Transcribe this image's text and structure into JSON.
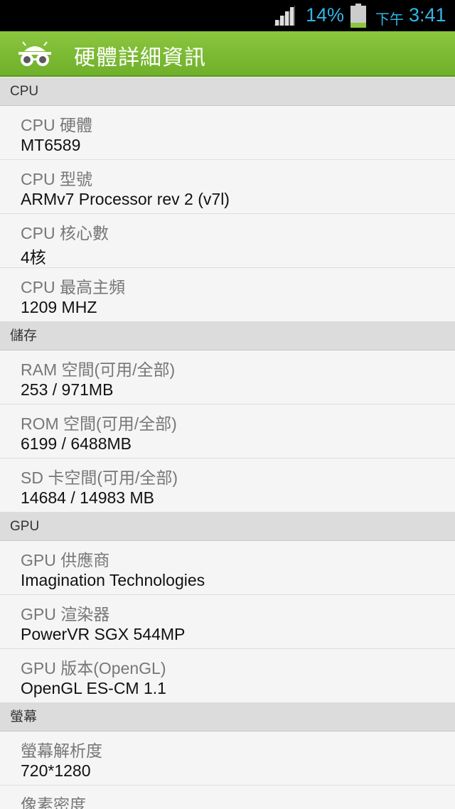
{
  "status_bar": {
    "battery_percent": "14%",
    "time_prefix": "下午",
    "time": "3:41",
    "accent_color": "#33b5e5"
  },
  "action_bar": {
    "title": "硬體詳細資訊",
    "icon": "glasses-robot-icon",
    "color": "#7cbb31"
  },
  "sections": [
    {
      "header": "CPU",
      "items": [
        {
          "label": "CPU 硬體",
          "value": "MT6589"
        },
        {
          "label": "CPU 型號",
          "value": "ARMv7 Processor rev 2 (v7l)"
        },
        {
          "label": "CPU 核心數",
          "value": "4核"
        },
        {
          "label": "CPU 最高主頻",
          "value": "1209 MHZ"
        }
      ]
    },
    {
      "header": "儲存",
      "items": [
        {
          "label": "RAM 空間(可用/全部)",
          "value": "253 / 971MB"
        },
        {
          "label": "ROM 空間(可用/全部)",
          "value": "6199 / 6488MB"
        },
        {
          "label": "SD 卡空間(可用/全部)",
          "value": "14684 / 14983 MB"
        }
      ]
    },
    {
      "header": "GPU",
      "items": [
        {
          "label": "GPU 供應商",
          "value": "Imagination Technologies"
        },
        {
          "label": "GPU 渲染器",
          "value": "PowerVR SGX 544MP"
        },
        {
          "label": "GPU 版本(OpenGL)",
          "value": "OpenGL ES-CM 1.1"
        }
      ]
    },
    {
      "header": "螢幕",
      "items": [
        {
          "label": "螢幕解析度",
          "value": "720*1280"
        },
        {
          "label": "像素密度",
          "value": ""
        }
      ]
    }
  ]
}
